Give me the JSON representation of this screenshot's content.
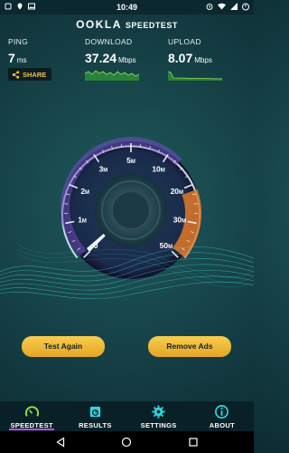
{
  "status_bar": {
    "time": "10:49",
    "left_icons": [
      "notification-icon",
      "location-icon",
      "image-icon"
    ],
    "right_icons": [
      "alarm-icon",
      "wifi-icon",
      "signal-icon",
      "battery-icon"
    ]
  },
  "header": {
    "brand": "OOKLA",
    "product": "SPEEDTEST"
  },
  "stats": {
    "ping": {
      "label": "PING",
      "value": "7",
      "unit": "ms"
    },
    "download": {
      "label": "DOWNLOAD",
      "value": "37.24",
      "unit": "Mbps"
    },
    "upload": {
      "label": "UPLOAD",
      "value": "8.07",
      "unit": "Mbps"
    },
    "share_label": "SHARE"
  },
  "gauge": {
    "ticks": [
      "0",
      "1",
      "2",
      "3",
      "5",
      "10",
      "20",
      "30",
      "50"
    ],
    "tick_units": [
      "",
      "M",
      "M",
      "M",
      "M",
      "M",
      "M",
      "M",
      "M"
    ],
    "value_fraction": 0.02
  },
  "buttons": {
    "test_again": "Test Again",
    "remove_ads": "Remove Ads"
  },
  "tabs": [
    {
      "label": "SPEEDTEST",
      "icon": "speedometer-icon",
      "active": true
    },
    {
      "label": "RESULTS",
      "icon": "results-icon",
      "active": false
    },
    {
      "label": "SETTINGS",
      "icon": "gear-icon",
      "active": false
    },
    {
      "label": "ABOUT",
      "icon": "info-icon",
      "active": false
    }
  ],
  "colors": {
    "accent_yellow": "#f5c243",
    "accent_teal": "#2fd6e0",
    "active_tab_underline": "#b84ee0",
    "arc_orange": "#e07a2a"
  }
}
